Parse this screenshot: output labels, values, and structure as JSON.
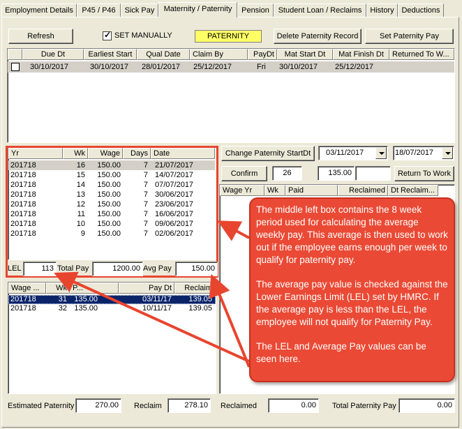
{
  "tabs": [
    "Employment Details",
    "P45 / P46",
    "Sick Pay",
    "Maternity / Paternity",
    "Pension",
    "Student Loan / Reclaims",
    "History",
    "Deductions"
  ],
  "toolbar": {
    "refresh": "Refresh",
    "set_manually": "SET MANUALLY",
    "set_manually_checked": true,
    "type_badge": "PATERNITY",
    "delete_record": "Delete Paternity Record",
    "set_pay": "Set Paternity Pay"
  },
  "top_grid": {
    "headers": [
      "Due Dt",
      "Earliest Start",
      "Qual Date",
      "Claim By",
      "PayDt",
      "Mat Start Dt",
      "Mat Finish Dt",
      "Returned To W..."
    ],
    "rows": [
      [
        "30/10/2017",
        "30/10/2017",
        "28/01/2017",
        "25/12/2017",
        "Fri",
        "30/10/2017",
        "25/12/2017",
        ""
      ]
    ]
  },
  "controls": {
    "change_start": "Change Paternity StartDt",
    "start_date": "03/11/2017",
    "second_date": "18/07/2017",
    "confirm": "Confirm",
    "weeks": "26",
    "amount": "135.00",
    "extra": "",
    "return_to_work": "Return To Work"
  },
  "wage_grid": {
    "headers": [
      "Yr",
      "Wk",
      "Wage",
      "Days",
      "Date"
    ],
    "rows": [
      [
        "201718",
        "16",
        "150.00",
        "7",
        "21/07/2017"
      ],
      [
        "201718",
        "15",
        "150.00",
        "7",
        "14/07/2017"
      ],
      [
        "201718",
        "14",
        "150.00",
        "7",
        "07/07/2017"
      ],
      [
        "201718",
        "13",
        "150.00",
        "7",
        "30/06/2017"
      ],
      [
        "201718",
        "12",
        "150.00",
        "7",
        "23/06/2017"
      ],
      [
        "201718",
        "11",
        "150.00",
        "7",
        "16/06/2017"
      ],
      [
        "201718",
        "10",
        "150.00",
        "7",
        "09/06/2017"
      ],
      [
        "201718",
        "9",
        "150.00",
        "7",
        "02/06/2017"
      ]
    ]
  },
  "totals": {
    "lel_label": "LEL",
    "lel": "113",
    "total_label": "Total Pay",
    "total": "1200.00",
    "avg_label": "Avg Pay",
    "avg": "150.00"
  },
  "pay_grid": {
    "headers": [
      "Wage ...",
      "Wk",
      "P...",
      "Pay Dt",
      "Reclaim"
    ],
    "rows": [
      [
        "201718",
        "31",
        "135.00",
        "03/11/17",
        "139.05"
      ],
      [
        "201718",
        "32",
        "135.00",
        "10/11/17",
        "139.05"
      ]
    ]
  },
  "right_grid": {
    "headers": [
      "Wage Yr",
      "Wk",
      "Paid",
      "Reclaimed",
      "Dt Reclaim..."
    ]
  },
  "footer": {
    "est_label": "Estimated Paternity",
    "est": "270.00",
    "reclaim_label": "Reclaim",
    "reclaim": "278.10",
    "reclaimed_label": "Reclaimed",
    "reclaimed": "0.00",
    "total_label": "Total Paternity Pay",
    "total": "0.00"
  },
  "callout": {
    "p1": "The middle left box contains the 8 week period used for calculating the average weekly pay. This average is then used to work out if the employee earns enough per week to qualify for paternity pay.",
    "p2": "The average pay value is checked against the Lower Earnings Limit (LEL) set by HMRC. If the average pay is less than the LEL, the employee will not qualify for Paternity Pay.",
    "p3": "The LEL and Average Pay values can be seen here."
  },
  "colors": {
    "annotation": "#ea4a35",
    "highlight_box": "#e8452f",
    "badge": "#ffff66",
    "selection": "#0a246a"
  }
}
